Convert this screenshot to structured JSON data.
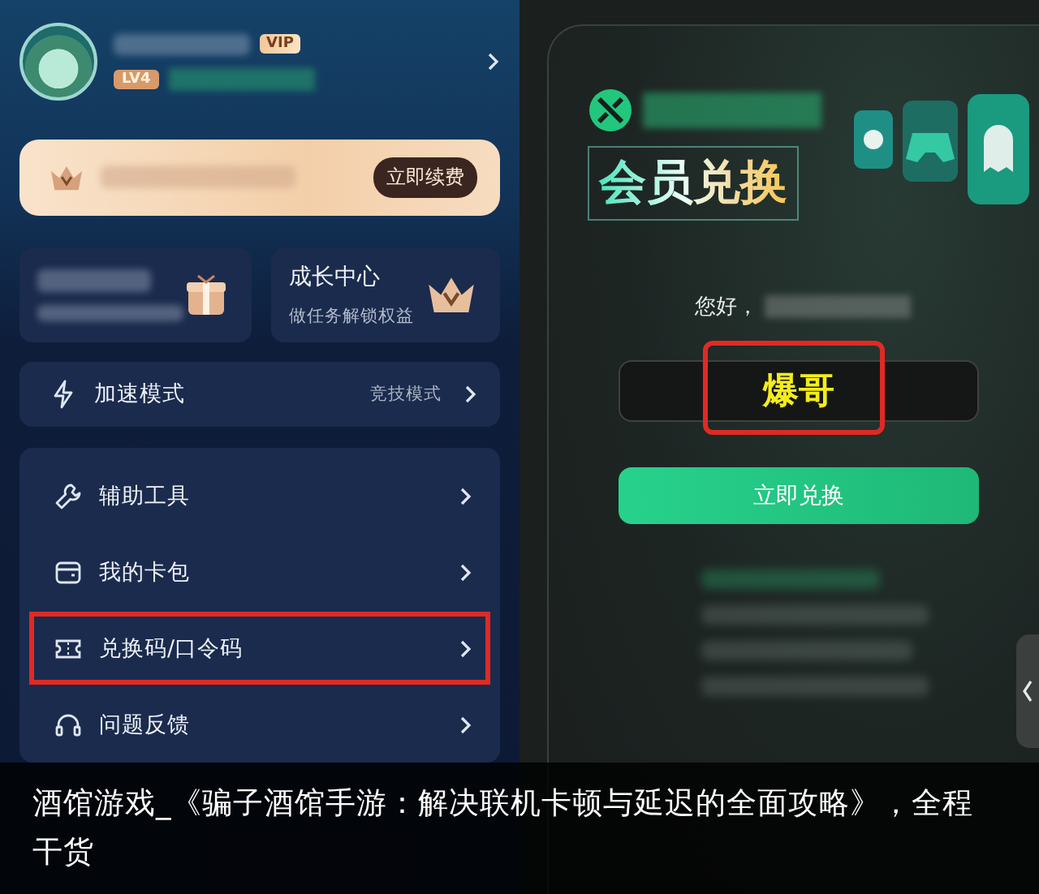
{
  "profile": {
    "vip_badge": "VIP",
    "level_badge": "LV4"
  },
  "renew_card": {
    "button": "立即续费"
  },
  "cards": [
    {
      "kind": "blurred"
    },
    {
      "kind": "growth",
      "title": "成长中心",
      "subtitle": "做任务解锁权益"
    }
  ],
  "mode_row": {
    "label": "加速模式",
    "value": "竞技模式"
  },
  "menu": [
    {
      "kind": "wrench",
      "label": "辅助工具",
      "highlighted": false
    },
    {
      "kind": "wallet",
      "label": "我的卡包",
      "highlighted": false
    },
    {
      "kind": "ticket",
      "label": "兑换码/口令码",
      "highlighted": true
    },
    {
      "kind": "headset",
      "label": "问题反馈",
      "highlighted": false
    }
  ],
  "redeem": {
    "title": "会员兑换",
    "greeting": "您好，",
    "code_field": {
      "value": "爆哥",
      "highlighted": true
    },
    "button": "立即兑换"
  },
  "caption": "酒馆游戏_《骗子酒馆手游：解决联机卡顿与延迟的全面攻略》，全程干货"
}
